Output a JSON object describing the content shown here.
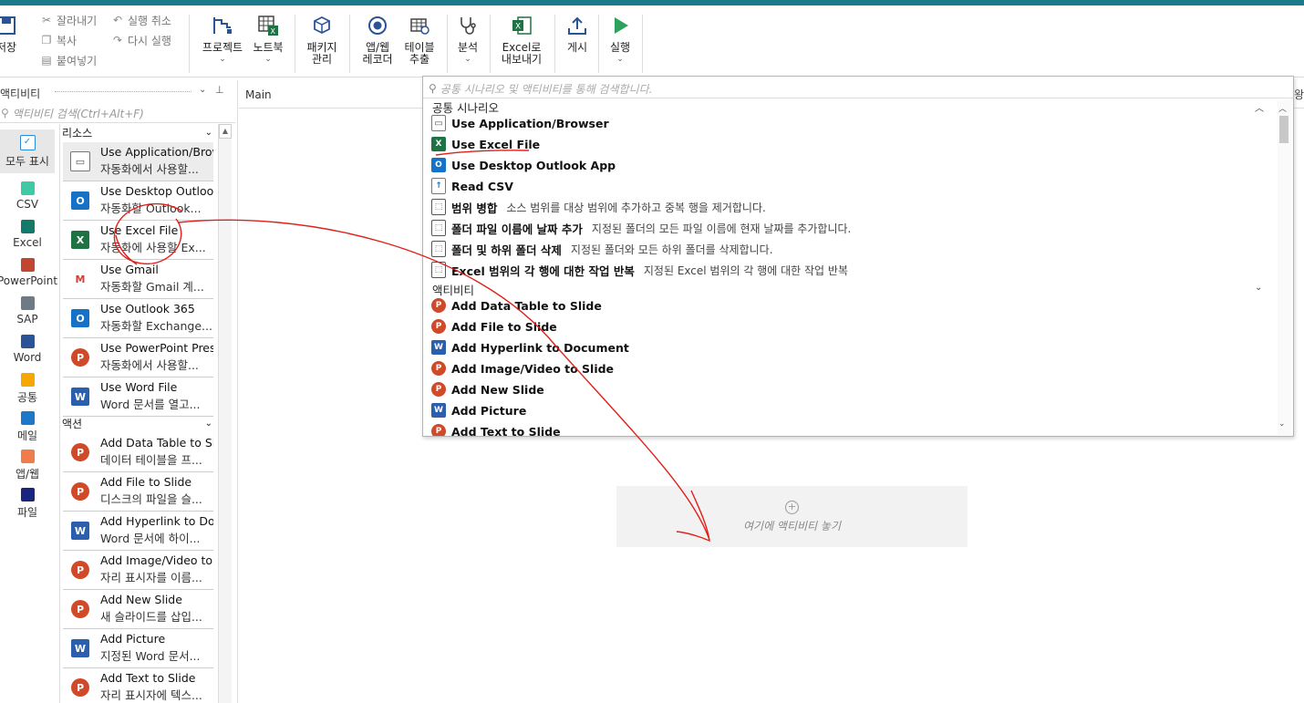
{
  "ribbon": {
    "save_label": "저장",
    "cut_label": "잘라내기",
    "copy_label": "복사",
    "paste_label": "붙여넣기",
    "undo_label": "실행 취소",
    "redo_label": "다시 실행",
    "project_label": "프로젝트",
    "notebook_label": "노트북",
    "package_label": "패키지\n관리",
    "app_web_recorder_label": "앱/웹\n레코더",
    "table_extract_label": "테이블\n추출",
    "analyze_label": "분석",
    "excel_export_label": "Excel로\n내보내기",
    "publish_label": "게시",
    "run_label": "실행"
  },
  "left_panel": {
    "title": "액티비티",
    "search_placeholder": "액티비티 검색(Ctrl+Alt+F)",
    "categories": [
      {
        "label": "모두 표시",
        "color": "#2a8bd8"
      },
      {
        "label": "CSV",
        "color": "#3ec9a7"
      },
      {
        "label": "Excel",
        "color": "#137a6a"
      },
      {
        "label": "PowerPoint",
        "color": "#c0462f"
      },
      {
        "label": "SAP",
        "color": "#6e7a86"
      },
      {
        "label": "Word",
        "color": "#2b5496"
      },
      {
        "label": "공통",
        "color": "#f6a800"
      },
      {
        "label": "메일",
        "color": "#1e78c8"
      },
      {
        "label": "앱/웹",
        "color": "#f07c4a"
      },
      {
        "label": "파일",
        "color": "#1a237e"
      }
    ],
    "resources_header": "리소스",
    "resources": [
      {
        "title": "Use Application/Brow",
        "desc": "자동화에서 사용할...",
        "icon": "app"
      },
      {
        "title": "Use Desktop Outlool",
        "desc": "자동화할 Outlook...",
        "icon": "ol"
      },
      {
        "title": "Use Excel File",
        "desc": "자동화에 사용할 Ex...",
        "icon": "xl"
      },
      {
        "title": "Use Gmail",
        "desc": "자동화할 Gmail 계...",
        "icon": "gm"
      },
      {
        "title": "Use Outlook 365",
        "desc": "자동화할 Exchange...",
        "icon": "ol"
      },
      {
        "title": "Use PowerPoint Pres",
        "desc": "자동화에서 사용할...",
        "icon": "pp"
      },
      {
        "title": "Use Word File",
        "desc": "Word 문서를 열고...",
        "icon": "wd"
      }
    ],
    "actions_header": "액션",
    "actions": [
      {
        "title": "Add Data Table to Sl",
        "desc": "데이터 테이블을 프...",
        "icon": "pp"
      },
      {
        "title": "Add File to Slide",
        "desc": "디스크의 파일을 슬...",
        "icon": "pp"
      },
      {
        "title": "Add Hyperlink to Do",
        "desc": "Word 문서에 하이...",
        "icon": "wd"
      },
      {
        "title": "Add Image/Video to",
        "desc": "자리 표시자를 이름...",
        "icon": "pp"
      },
      {
        "title": "Add New Slide",
        "desc": "새 슬라이드를 삽입...",
        "icon": "pp"
      },
      {
        "title": "Add Picture",
        "desc": "지정된 Word 문서...",
        "icon": "wd"
      },
      {
        "title": "Add Text to Slide",
        "desc": "자리 표시자에 텍스...",
        "icon": "pp"
      }
    ]
  },
  "canvas": {
    "tab_label": "Main",
    "drop_text": "여기에 액티비티 놓기"
  },
  "popup": {
    "search_placeholder": "공통 시나리오 및 액티비티를 통해 검색합니다.",
    "common_header": "공통 시나리오",
    "common": [
      {
        "title": "Use Application/Browser",
        "desc": "",
        "icon": "app"
      },
      {
        "title": "Use Excel File",
        "desc": "",
        "icon": "xl"
      },
      {
        "title": "Use Desktop Outlook App",
        "desc": "",
        "icon": "ol"
      },
      {
        "title": "Read CSV",
        "desc": "",
        "icon": "csv"
      },
      {
        "title": "범위 병합",
        "desc": "소스 범위를 대상 범위에 추가하고 중복 행을 제거합니다.",
        "icon": "gen"
      },
      {
        "title": "폴더 파일 이름에 날짜 추가",
        "desc": "지정된 폴더의 모든 파일 이름에 현재 날짜를 추가합니다.",
        "icon": "gen"
      },
      {
        "title": "폴더 및 하위 폴더 삭제",
        "desc": "지정된 폴더와 모든 하위 폴더를 삭제합니다.",
        "icon": "gen"
      },
      {
        "title": "Excel 범위의 각 행에 대한 작업 반복",
        "desc": "지정된 Excel 범위의 각 행에 대한 작업 반복",
        "icon": "gen"
      }
    ],
    "activities_header": "액티비티",
    "activities": [
      {
        "title": "Add Data Table to Slide",
        "desc": "",
        "icon": "pp"
      },
      {
        "title": "Add File to Slide",
        "desc": "",
        "icon": "pp"
      },
      {
        "title": "Add Hyperlink to Document",
        "desc": "",
        "icon": "wd"
      },
      {
        "title": "Add Image/Video to Slide",
        "desc": "",
        "icon": "pp"
      },
      {
        "title": "Add New Slide",
        "desc": "",
        "icon": "pp"
      },
      {
        "title": "Add Picture",
        "desc": "",
        "icon": "wd"
      },
      {
        "title": "Add Text to Slide",
        "desc": "",
        "icon": "pp"
      }
    ]
  },
  "colors": {
    "accent": "#1b7a8c",
    "annotation": "#e0201a"
  }
}
